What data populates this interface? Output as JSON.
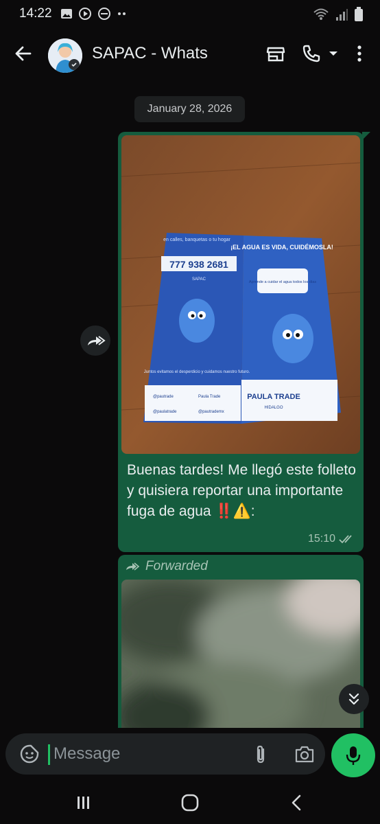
{
  "status_bar": {
    "time": "14:22",
    "icons_left": [
      "gallery-icon",
      "play-circle-icon",
      "do-not-disturb-icon",
      "more-dots-icon"
    ],
    "icons_right": [
      "wifi-icon",
      "signal-icon",
      "battery-icon"
    ]
  },
  "app_bar": {
    "title": "SAPAC - Whats",
    "icons": [
      "back-arrow-icon",
      "store-icon",
      "phone-icon",
      "caret-down-icon",
      "more-vert-icon"
    ]
  },
  "chat": {
    "date_chip": "January 28, 2026",
    "messages": [
      {
        "type": "image",
        "image_description_text": {
          "phone_number": "777 938 2681",
          "headline_1": "¡EL AGUA ES VIDA, CUIDÉMOSLA!",
          "headline_2": "Aprende a cuidar el agua todos los dias",
          "small_1": "en calles, banquetas o tu hogar",
          "small_2": "SAPAC",
          "footer": "Juntos evitamos el desperdicio y cuidamos nuestro futuro.",
          "social_1": "@pautrade",
          "social_2": "Paula Trade",
          "social_3": "@paulatrade",
          "social_4": "@pautrademx",
          "brand": "PAULA TRADE",
          "brand_sub": "HIDALGO"
        },
        "text": "Buenas tardes! Me llegó este folleto y quisiera reportar una importante fuga de agua ‼️⚠️:",
        "time": "15:10",
        "status": "read-double-check"
      },
      {
        "type": "image",
        "forwarded_label": "Forwarded",
        "blurred": true
      }
    ]
  },
  "input_bar": {
    "placeholder": "Message",
    "icons": [
      "sticker-icon",
      "attach-icon",
      "camera-icon",
      "mic-icon"
    ]
  },
  "nav_bar": {
    "icons": [
      "recents-icon",
      "home-icon",
      "back-icon"
    ]
  },
  "colors": {
    "background": "#0b0a0b",
    "bubble_outgoing": "#155c3e",
    "accent_green": "#21c063",
    "chip": "#1d1f20"
  }
}
